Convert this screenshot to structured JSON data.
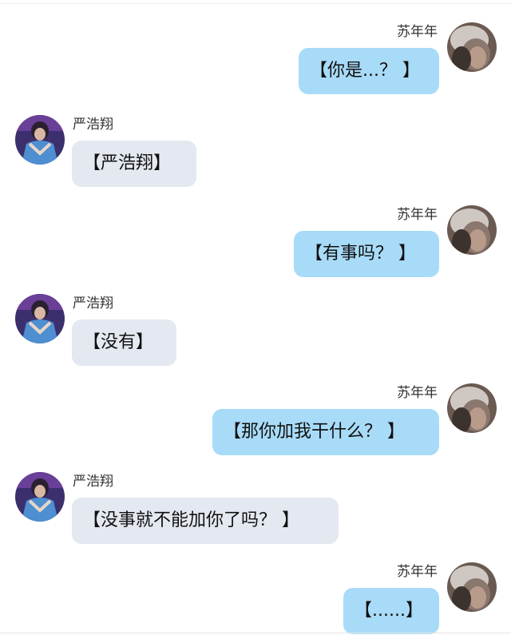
{
  "conversation": {
    "messages": [
      {
        "side": "right",
        "sender": "苏年年",
        "text": "【你是...？ 】"
      },
      {
        "side": "left",
        "sender": "严浩翔",
        "text": "【严浩翔】"
      },
      {
        "side": "right",
        "sender": "苏年年",
        "text": "【有事吗？ 】"
      },
      {
        "side": "left",
        "sender": "严浩翔",
        "text": "【没有】"
      },
      {
        "side": "right",
        "sender": "苏年年",
        "text": "【那你加我干什么？ 】"
      },
      {
        "side": "left",
        "sender": "严浩翔",
        "text": "【没事就不能加你了吗？ 】"
      },
      {
        "side": "right",
        "sender": "苏年年",
        "text": "【......】"
      }
    ]
  },
  "colors": {
    "right_bubble": "#a8dbf8",
    "left_bubble": "#e4e8f0"
  }
}
